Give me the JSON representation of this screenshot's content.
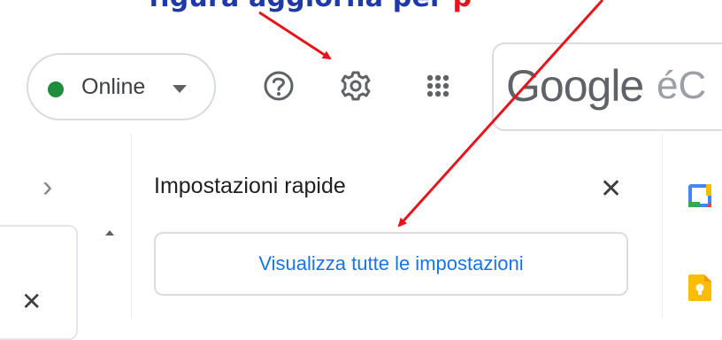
{
  "caption": {
    "text_blue": "figura aggiorna per",
    "text_red": "p"
  },
  "status": {
    "label": "Online",
    "dot_color": "#1e8e3e"
  },
  "header_icons": [
    "help-icon",
    "settings-gear-icon",
    "apps-grid-icon"
  ],
  "search": {
    "logo_text": "Google",
    "suffix_text": "éC"
  },
  "quick_settings": {
    "title": "Impostazioni rapide",
    "close_glyph": "✕",
    "view_all_button": "Visualizza tutte le impostazioni"
  },
  "left_panel": {
    "expand_glyph": "›",
    "close_glyph": "✕"
  },
  "side_apps": [
    "calendar-icon",
    "keep-icon"
  ],
  "colors": {
    "accent": "#1a73e8",
    "annotation_red": "#e6141b",
    "annotation_blue": "#1f3aa8"
  }
}
